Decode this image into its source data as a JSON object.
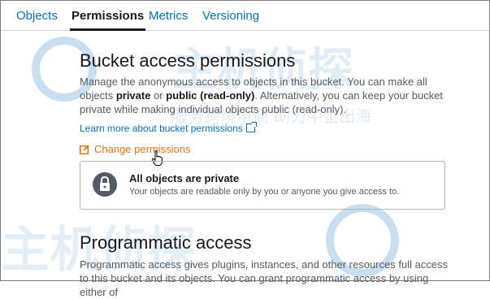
{
  "tabs": [
    {
      "label": "Objects",
      "active": false
    },
    {
      "label": "Permissions",
      "active": true
    },
    {
      "label": "Metrics",
      "active": false
    },
    {
      "label": "Versioning",
      "active": false
    }
  ],
  "watermark": {
    "line1": "主机侦探",
    "line2": "服务跨境电商 助力中企出海"
  },
  "bucket_access": {
    "title": "Bucket access permissions",
    "desc_part1": "Manage the anonymous access to objects in this bucket. You can make all objects ",
    "desc_bold1": "private",
    "desc_part2": " or ",
    "desc_bold2": "public (read-only)",
    "desc_part3": ". Alternatively, you can keep your bucket private while making individual objects public (read-only).",
    "learn_more": "Learn more about bucket permissions",
    "change_label": "Change permissions",
    "status_title": "All objects are private",
    "status_desc": "Your objects are readable only by you or anyone you give access to."
  },
  "programmatic": {
    "title": "Programmatic access",
    "desc": "Programmatic access gives plugins, instances, and other resources full access to this bucket and its objects. You can grant programmatic access by using either of"
  },
  "colors": {
    "link": "#0073bb",
    "accent": "#ec7211",
    "text": "#16191f"
  },
  "icons": {
    "external": "external-link-icon",
    "edit": "edit-icon",
    "lock": "lock-icon",
    "cursor": "hand-cursor-icon"
  }
}
